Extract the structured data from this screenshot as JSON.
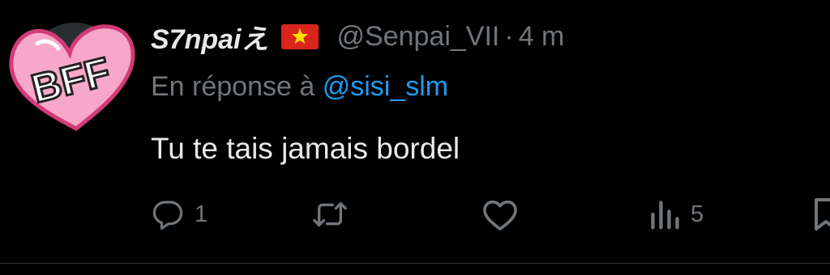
{
  "avatar": {
    "text": "BFF"
  },
  "tweet": {
    "display_name": "S7npaiえ",
    "handle": "@Senpai_VII",
    "separator": "·",
    "time": "4 m",
    "reply_prefix": "En réponse à",
    "reply_to": "@sisi_slm",
    "text": "Tu te tais jamais bordel"
  },
  "actions": {
    "reply": {
      "icon": "reply-icon",
      "count": "1"
    },
    "retweet": {
      "icon": "retweet-icon"
    },
    "like": {
      "icon": "heart-icon"
    },
    "views": {
      "icon": "views-icon",
      "count": "5"
    },
    "bookmark": {
      "icon": "bookmark-icon"
    }
  },
  "colors": {
    "background": "#000000",
    "text": "#e7e9ea",
    "muted": "#71767b",
    "accent": "#1d9bf0",
    "avatar_pink": "#f7a8c8",
    "avatar_outline": "#d23a7a"
  }
}
